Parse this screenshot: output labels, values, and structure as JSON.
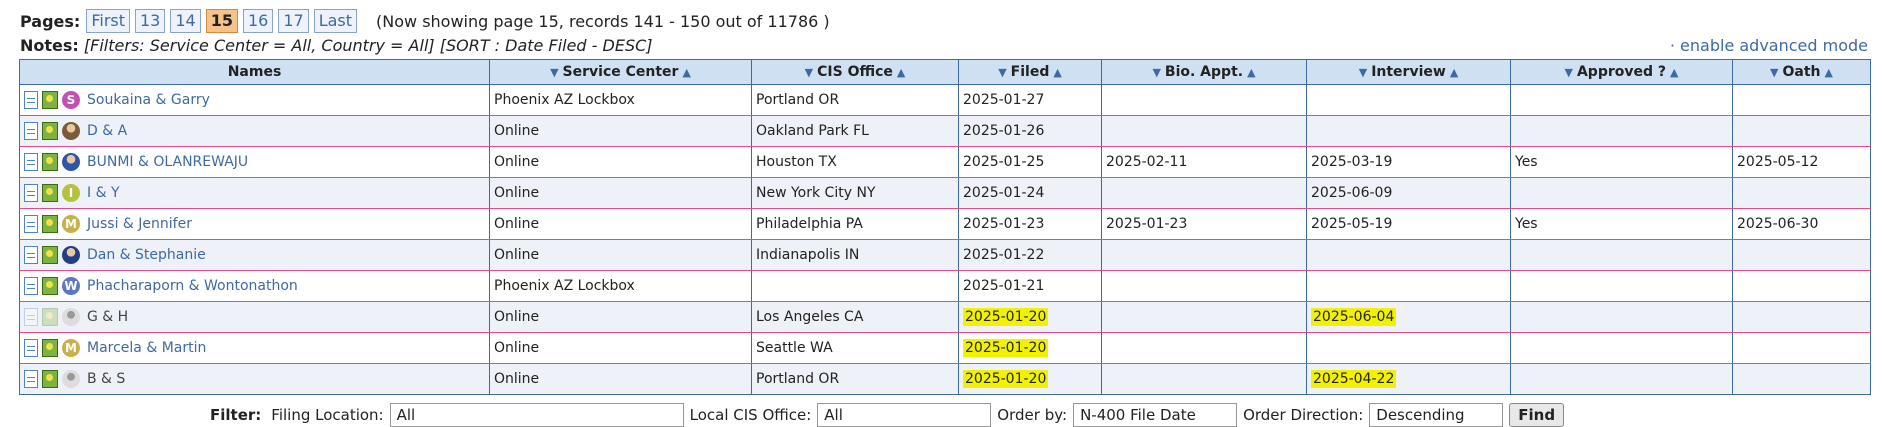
{
  "pager": {
    "label": "Pages:",
    "pages": [
      {
        "label": "First",
        "current": false
      },
      {
        "label": "13",
        "current": false
      },
      {
        "label": "14",
        "current": false
      },
      {
        "label": "15",
        "current": true
      },
      {
        "label": "16",
        "current": false
      },
      {
        "label": "17",
        "current": false
      },
      {
        "label": "Last",
        "current": false
      }
    ],
    "status": "(Now showing page 15, records 141 - 150 out of 11786 )"
  },
  "notes": {
    "label": "Notes:",
    "text": "[Filters: Service Center = All, Country = All] [SORT : Date Filed - DESC]",
    "advanced_link": "· enable advanced mode"
  },
  "table": {
    "columns": [
      "Names",
      "Service Center",
      "CIS Office",
      "Filed",
      "Bio. Appt.",
      "Interview",
      "Approved ?",
      "Oath"
    ],
    "rows": [
      {
        "name": "Soukaina & Garry",
        "avatar": "S",
        "avatar_color": "#c44fb4",
        "service_center": "Phoenix AZ Lockbox",
        "cis_office": "Portland OR",
        "filed": "2025-01-27",
        "bio": "",
        "interview": "",
        "approved": "",
        "oath": "",
        "hl_filed": false,
        "hl_interview": false,
        "dim_icons": false,
        "photo": false
      },
      {
        "name": "D & A",
        "avatar": "",
        "avatar_color": "#7a5b3a",
        "service_center": "Online",
        "cis_office": "Oakland Park FL",
        "filed": "2025-01-26",
        "bio": "",
        "interview": "",
        "approved": "",
        "oath": "",
        "hl_filed": false,
        "hl_interview": false,
        "dim_icons": false,
        "photo": true
      },
      {
        "name": "BUNMI & OLANREWAJU",
        "avatar": "",
        "avatar_color": "#2f56a6",
        "service_center": "Online",
        "cis_office": "Houston TX",
        "filed": "2025-01-25",
        "bio": "2025-02-11",
        "interview": "2025-03-19",
        "approved": "Yes",
        "oath": "2025-05-12",
        "hl_filed": false,
        "hl_interview": false,
        "dim_icons": false,
        "photo": true
      },
      {
        "name": "I & Y",
        "avatar": "I",
        "avatar_color": "#b5c13f",
        "service_center": "Online",
        "cis_office": "New York City NY",
        "filed": "2025-01-24",
        "bio": "",
        "interview": "2025-06-09",
        "approved": "",
        "oath": "",
        "hl_filed": false,
        "hl_interview": false,
        "dim_icons": false,
        "photo": false
      },
      {
        "name": "Jussi & Jennifer",
        "avatar": "M",
        "avatar_color": "#c8b04a",
        "service_center": "Online",
        "cis_office": "Philadelphia PA",
        "filed": "2025-01-23",
        "bio": "2025-01-23",
        "interview": "2025-05-19",
        "approved": "Yes",
        "oath": "2025-06-30",
        "hl_filed": false,
        "hl_interview": false,
        "dim_icons": false,
        "photo": false
      },
      {
        "name": "Dan & Stephanie",
        "avatar": "",
        "avatar_color": "#1f3f86",
        "service_center": "Online",
        "cis_office": "Indianapolis IN",
        "filed": "2025-01-22",
        "bio": "",
        "interview": "",
        "approved": "",
        "oath": "",
        "hl_filed": false,
        "hl_interview": false,
        "dim_icons": false,
        "photo": true
      },
      {
        "name": "Phacharaporn & Wontonathon",
        "avatar": "W",
        "avatar_color": "#5a78c4",
        "service_center": "Phoenix AZ Lockbox",
        "cis_office": "",
        "filed": "2025-01-21",
        "bio": "",
        "interview": "",
        "approved": "",
        "oath": "",
        "hl_filed": false,
        "hl_interview": false,
        "dim_icons": false,
        "photo": false
      },
      {
        "name": "G & H",
        "avatar": "",
        "avatar_color": "#cccccc",
        "service_center": "Online",
        "cis_office": "Los Angeles CA",
        "filed": "2025-01-20",
        "bio": "",
        "interview": "2025-06-04",
        "approved": "",
        "oath": "",
        "hl_filed": true,
        "hl_interview": true,
        "dim_icons": true,
        "photo": false
      },
      {
        "name": "Marcela & Martin",
        "avatar": "M",
        "avatar_color": "#c8b04a",
        "service_center": "Online",
        "cis_office": "Seattle WA",
        "filed": "2025-01-20",
        "bio": "",
        "interview": "",
        "approved": "",
        "oath": "",
        "hl_filed": true,
        "hl_interview": false,
        "dim_icons": false,
        "photo": false
      },
      {
        "name": "B & S",
        "avatar": "",
        "avatar_color": "#bbbbbb",
        "service_center": "Online",
        "cis_office": "Portland OR",
        "filed": "2025-01-20",
        "bio": "",
        "interview": "2025-04-22",
        "approved": "",
        "oath": "",
        "hl_filed": true,
        "hl_interview": true,
        "dim_icons": false,
        "photo": false
      }
    ]
  },
  "filter": {
    "label": "Filter:",
    "filing_location_label": "Filing Location:",
    "filing_location_value": "All",
    "local_office_label": "Local CIS Office:",
    "local_office_value": "All",
    "order_by_label": "Order by:",
    "order_by_value": "N-400 File Date",
    "order_dir_label": "Order Direction:",
    "order_dir_value": "Descending",
    "find_label": "Find"
  }
}
